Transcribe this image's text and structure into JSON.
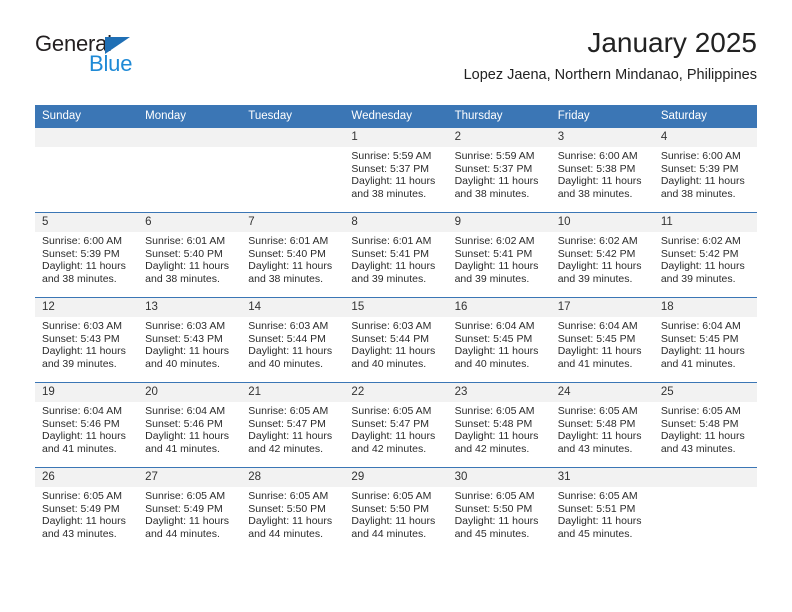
{
  "brand": {
    "name_part1": "General",
    "name_part2": "Blue",
    "logo_icon": "triangle-flag-icon",
    "accent_color": "#1f8ad6",
    "triangle_color": "#1f6fb5"
  },
  "header": {
    "title": "January 2025",
    "subtitle": "Lopez Jaena, Northern Mindanao, Philippines"
  },
  "calendar": {
    "header_bg": "#3b76b5",
    "daynum_bg": "#f2f2f2",
    "weekday_headers": [
      "Sunday",
      "Monday",
      "Tuesday",
      "Wednesday",
      "Thursday",
      "Friday",
      "Saturday"
    ],
    "weeks": [
      [
        {
          "day": "",
          "sunrise": "",
          "sunset": "",
          "daylight_line1": "",
          "daylight_line2": ""
        },
        {
          "day": "",
          "sunrise": "",
          "sunset": "",
          "daylight_line1": "",
          "daylight_line2": ""
        },
        {
          "day": "",
          "sunrise": "",
          "sunset": "",
          "daylight_line1": "",
          "daylight_line2": ""
        },
        {
          "day": "1",
          "sunrise": "Sunrise: 5:59 AM",
          "sunset": "Sunset: 5:37 PM",
          "daylight_line1": "Daylight: 11 hours",
          "daylight_line2": "and 38 minutes."
        },
        {
          "day": "2",
          "sunrise": "Sunrise: 5:59 AM",
          "sunset": "Sunset: 5:37 PM",
          "daylight_line1": "Daylight: 11 hours",
          "daylight_line2": "and 38 minutes."
        },
        {
          "day": "3",
          "sunrise": "Sunrise: 6:00 AM",
          "sunset": "Sunset: 5:38 PM",
          "daylight_line1": "Daylight: 11 hours",
          "daylight_line2": "and 38 minutes."
        },
        {
          "day": "4",
          "sunrise": "Sunrise: 6:00 AM",
          "sunset": "Sunset: 5:39 PM",
          "daylight_line1": "Daylight: 11 hours",
          "daylight_line2": "and 38 minutes."
        }
      ],
      [
        {
          "day": "5",
          "sunrise": "Sunrise: 6:00 AM",
          "sunset": "Sunset: 5:39 PM",
          "daylight_line1": "Daylight: 11 hours",
          "daylight_line2": "and 38 minutes."
        },
        {
          "day": "6",
          "sunrise": "Sunrise: 6:01 AM",
          "sunset": "Sunset: 5:40 PM",
          "daylight_line1": "Daylight: 11 hours",
          "daylight_line2": "and 38 minutes."
        },
        {
          "day": "7",
          "sunrise": "Sunrise: 6:01 AM",
          "sunset": "Sunset: 5:40 PM",
          "daylight_line1": "Daylight: 11 hours",
          "daylight_line2": "and 38 minutes."
        },
        {
          "day": "8",
          "sunrise": "Sunrise: 6:01 AM",
          "sunset": "Sunset: 5:41 PM",
          "daylight_line1": "Daylight: 11 hours",
          "daylight_line2": "and 39 minutes."
        },
        {
          "day": "9",
          "sunrise": "Sunrise: 6:02 AM",
          "sunset": "Sunset: 5:41 PM",
          "daylight_line1": "Daylight: 11 hours",
          "daylight_line2": "and 39 minutes."
        },
        {
          "day": "10",
          "sunrise": "Sunrise: 6:02 AM",
          "sunset": "Sunset: 5:42 PM",
          "daylight_line1": "Daylight: 11 hours",
          "daylight_line2": "and 39 minutes."
        },
        {
          "day": "11",
          "sunrise": "Sunrise: 6:02 AM",
          "sunset": "Sunset: 5:42 PM",
          "daylight_line1": "Daylight: 11 hours",
          "daylight_line2": "and 39 minutes."
        }
      ],
      [
        {
          "day": "12",
          "sunrise": "Sunrise: 6:03 AM",
          "sunset": "Sunset: 5:43 PM",
          "daylight_line1": "Daylight: 11 hours",
          "daylight_line2": "and 39 minutes."
        },
        {
          "day": "13",
          "sunrise": "Sunrise: 6:03 AM",
          "sunset": "Sunset: 5:43 PM",
          "daylight_line1": "Daylight: 11 hours",
          "daylight_line2": "and 40 minutes."
        },
        {
          "day": "14",
          "sunrise": "Sunrise: 6:03 AM",
          "sunset": "Sunset: 5:44 PM",
          "daylight_line1": "Daylight: 11 hours",
          "daylight_line2": "and 40 minutes."
        },
        {
          "day": "15",
          "sunrise": "Sunrise: 6:03 AM",
          "sunset": "Sunset: 5:44 PM",
          "daylight_line1": "Daylight: 11 hours",
          "daylight_line2": "and 40 minutes."
        },
        {
          "day": "16",
          "sunrise": "Sunrise: 6:04 AM",
          "sunset": "Sunset: 5:45 PM",
          "daylight_line1": "Daylight: 11 hours",
          "daylight_line2": "and 40 minutes."
        },
        {
          "day": "17",
          "sunrise": "Sunrise: 6:04 AM",
          "sunset": "Sunset: 5:45 PM",
          "daylight_line1": "Daylight: 11 hours",
          "daylight_line2": "and 41 minutes."
        },
        {
          "day": "18",
          "sunrise": "Sunrise: 6:04 AM",
          "sunset": "Sunset: 5:45 PM",
          "daylight_line1": "Daylight: 11 hours",
          "daylight_line2": "and 41 minutes."
        }
      ],
      [
        {
          "day": "19",
          "sunrise": "Sunrise: 6:04 AM",
          "sunset": "Sunset: 5:46 PM",
          "daylight_line1": "Daylight: 11 hours",
          "daylight_line2": "and 41 minutes."
        },
        {
          "day": "20",
          "sunrise": "Sunrise: 6:04 AM",
          "sunset": "Sunset: 5:46 PM",
          "daylight_line1": "Daylight: 11 hours",
          "daylight_line2": "and 41 minutes."
        },
        {
          "day": "21",
          "sunrise": "Sunrise: 6:05 AM",
          "sunset": "Sunset: 5:47 PM",
          "daylight_line1": "Daylight: 11 hours",
          "daylight_line2": "and 42 minutes."
        },
        {
          "day": "22",
          "sunrise": "Sunrise: 6:05 AM",
          "sunset": "Sunset: 5:47 PM",
          "daylight_line1": "Daylight: 11 hours",
          "daylight_line2": "and 42 minutes."
        },
        {
          "day": "23",
          "sunrise": "Sunrise: 6:05 AM",
          "sunset": "Sunset: 5:48 PM",
          "daylight_line1": "Daylight: 11 hours",
          "daylight_line2": "and 42 minutes."
        },
        {
          "day": "24",
          "sunrise": "Sunrise: 6:05 AM",
          "sunset": "Sunset: 5:48 PM",
          "daylight_line1": "Daylight: 11 hours",
          "daylight_line2": "and 43 minutes."
        },
        {
          "day": "25",
          "sunrise": "Sunrise: 6:05 AM",
          "sunset": "Sunset: 5:48 PM",
          "daylight_line1": "Daylight: 11 hours",
          "daylight_line2": "and 43 minutes."
        }
      ],
      [
        {
          "day": "26",
          "sunrise": "Sunrise: 6:05 AM",
          "sunset": "Sunset: 5:49 PM",
          "daylight_line1": "Daylight: 11 hours",
          "daylight_line2": "and 43 minutes."
        },
        {
          "day": "27",
          "sunrise": "Sunrise: 6:05 AM",
          "sunset": "Sunset: 5:49 PM",
          "daylight_line1": "Daylight: 11 hours",
          "daylight_line2": "and 44 minutes."
        },
        {
          "day": "28",
          "sunrise": "Sunrise: 6:05 AM",
          "sunset": "Sunset: 5:50 PM",
          "daylight_line1": "Daylight: 11 hours",
          "daylight_line2": "and 44 minutes."
        },
        {
          "day": "29",
          "sunrise": "Sunrise: 6:05 AM",
          "sunset": "Sunset: 5:50 PM",
          "daylight_line1": "Daylight: 11 hours",
          "daylight_line2": "and 44 minutes."
        },
        {
          "day": "30",
          "sunrise": "Sunrise: 6:05 AM",
          "sunset": "Sunset: 5:50 PM",
          "daylight_line1": "Daylight: 11 hours",
          "daylight_line2": "and 45 minutes."
        },
        {
          "day": "31",
          "sunrise": "Sunrise: 6:05 AM",
          "sunset": "Sunset: 5:51 PM",
          "daylight_line1": "Daylight: 11 hours",
          "daylight_line2": "and 45 minutes."
        },
        {
          "day": "",
          "sunrise": "",
          "sunset": "",
          "daylight_line1": "",
          "daylight_line2": ""
        }
      ]
    ]
  }
}
